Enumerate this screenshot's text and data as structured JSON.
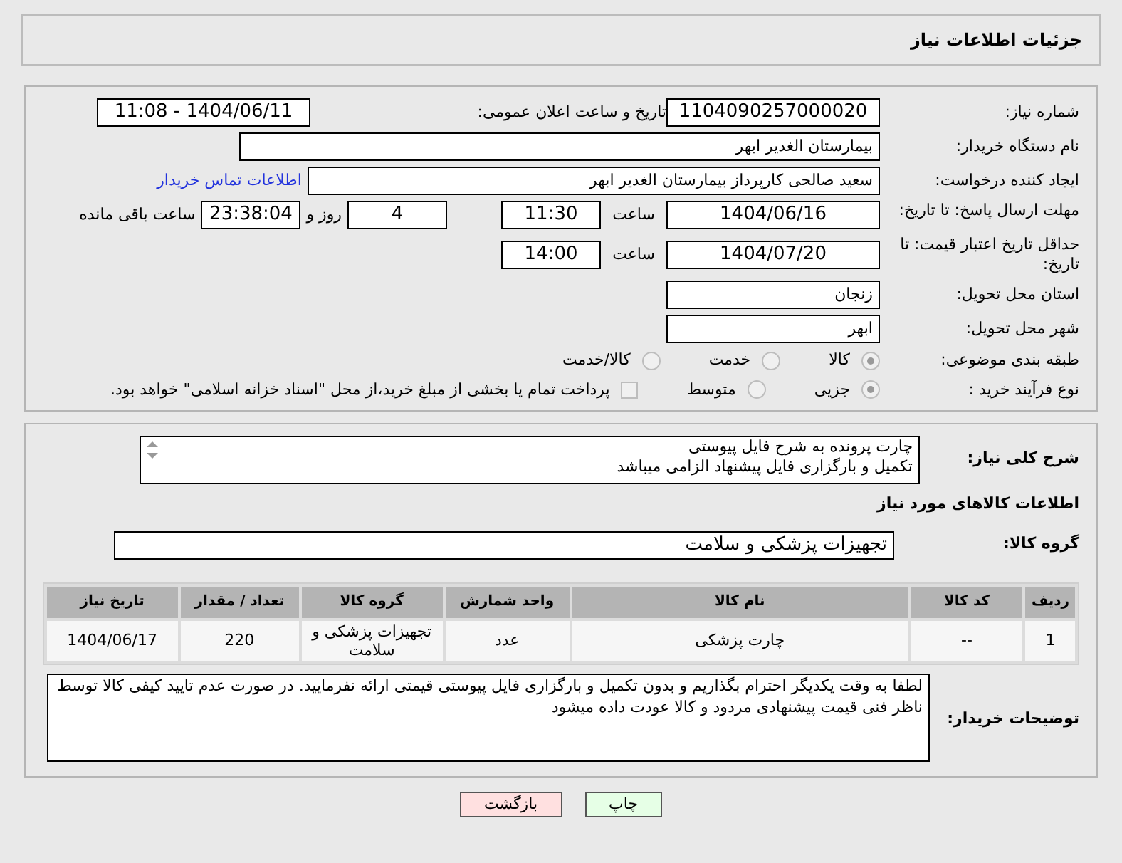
{
  "header": {
    "title": "جزئیات اطلاعات نیاز"
  },
  "need_number": {
    "label": "شماره نیاز:",
    "value": "1104090257000020"
  },
  "announce": {
    "label": "تاریخ و ساعت اعلان عمومی:",
    "value": "1404/06/11 - 11:08"
  },
  "buyer_org": {
    "label": "نام دستگاه خریدار:",
    "value": "بیمارستان الغدیر ابهر"
  },
  "creator": {
    "label": "ایجاد کننده درخواست:",
    "value": "سعید صالحی کارپرداز بیمارستان الغدیر ابهر",
    "link": "اطلاعات تماس خریدار"
  },
  "deadline": {
    "label": "مهلت ارسال پاسخ: تا تاریخ:",
    "date": "1404/06/16",
    "time_label": "ساعت",
    "time": "11:30",
    "days": "4",
    "days_label": "روز و",
    "remaining": "23:38:04",
    "remaining_label": "ساعت باقی مانده"
  },
  "validity": {
    "label": "حداقل تاریخ اعتبار قیمت: تا تاریخ:",
    "date": "1404/07/20",
    "time_label": "ساعت",
    "time": "14:00"
  },
  "province": {
    "label": "استان محل تحویل:",
    "value": "زنجان"
  },
  "city": {
    "label": "شهر محل تحویل:",
    "value": "ابهر"
  },
  "category": {
    "label": "طبقه بندی موضوعی:",
    "options": [
      {
        "label": "کالا",
        "selected": true
      },
      {
        "label": "خدمت",
        "selected": false
      },
      {
        "label": "کالا/خدمت",
        "selected": false
      }
    ]
  },
  "process": {
    "label": "نوع فرآیند خرید :",
    "options": [
      {
        "label": "جزیی",
        "selected": true
      },
      {
        "label": "متوسط",
        "selected": false
      }
    ],
    "payment": {
      "label": "پرداخت تمام یا بخشی از مبلغ خرید،از محل \"اسناد خزانه اسلامی\" خواهد بود.",
      "checked": false
    }
  },
  "description": {
    "label": "شرح کلی نیاز:",
    "lines": [
      "چارت پرونده به شرح فایل پیوستی",
      "تکمیل و بارگزاری فایل پیشنهاد الزامی میباشد"
    ]
  },
  "goods_heading": "اطلاعات کالاهای مورد نیاز",
  "goods_group": {
    "label": "گروه کالا:",
    "value": "تجهیزات پزشکی و سلامت"
  },
  "table": {
    "columns": [
      "ردیف",
      "کد کالا",
      "نام کالا",
      "واحد شمارش",
      "گروه کالا",
      "تعداد / مقدار",
      "تاریخ نیاز"
    ],
    "rows": [
      [
        "1",
        "--",
        "چارت پزشکی",
        "عدد",
        "تجهیزات پزشکی و سلامت",
        "220",
        "1404/06/17"
      ]
    ]
  },
  "buyer_notes": {
    "label": "توضیحات خریدار:",
    "value": "لطفا به وقت یکدیگر احترام بگذاریم و بدون تکمیل و بارگزاری فایل پیوستی قیمتی ارائه نفرمایید. در صورت عدم تایید کیفی کالا توسط ناظر فنی قیمت پیشنهادی مردود و کالا عودت داده میشود"
  },
  "buttons": [
    {
      "kind": "print",
      "label": "چاپ"
    },
    {
      "kind": "back",
      "label": "بازگشت"
    }
  ]
}
